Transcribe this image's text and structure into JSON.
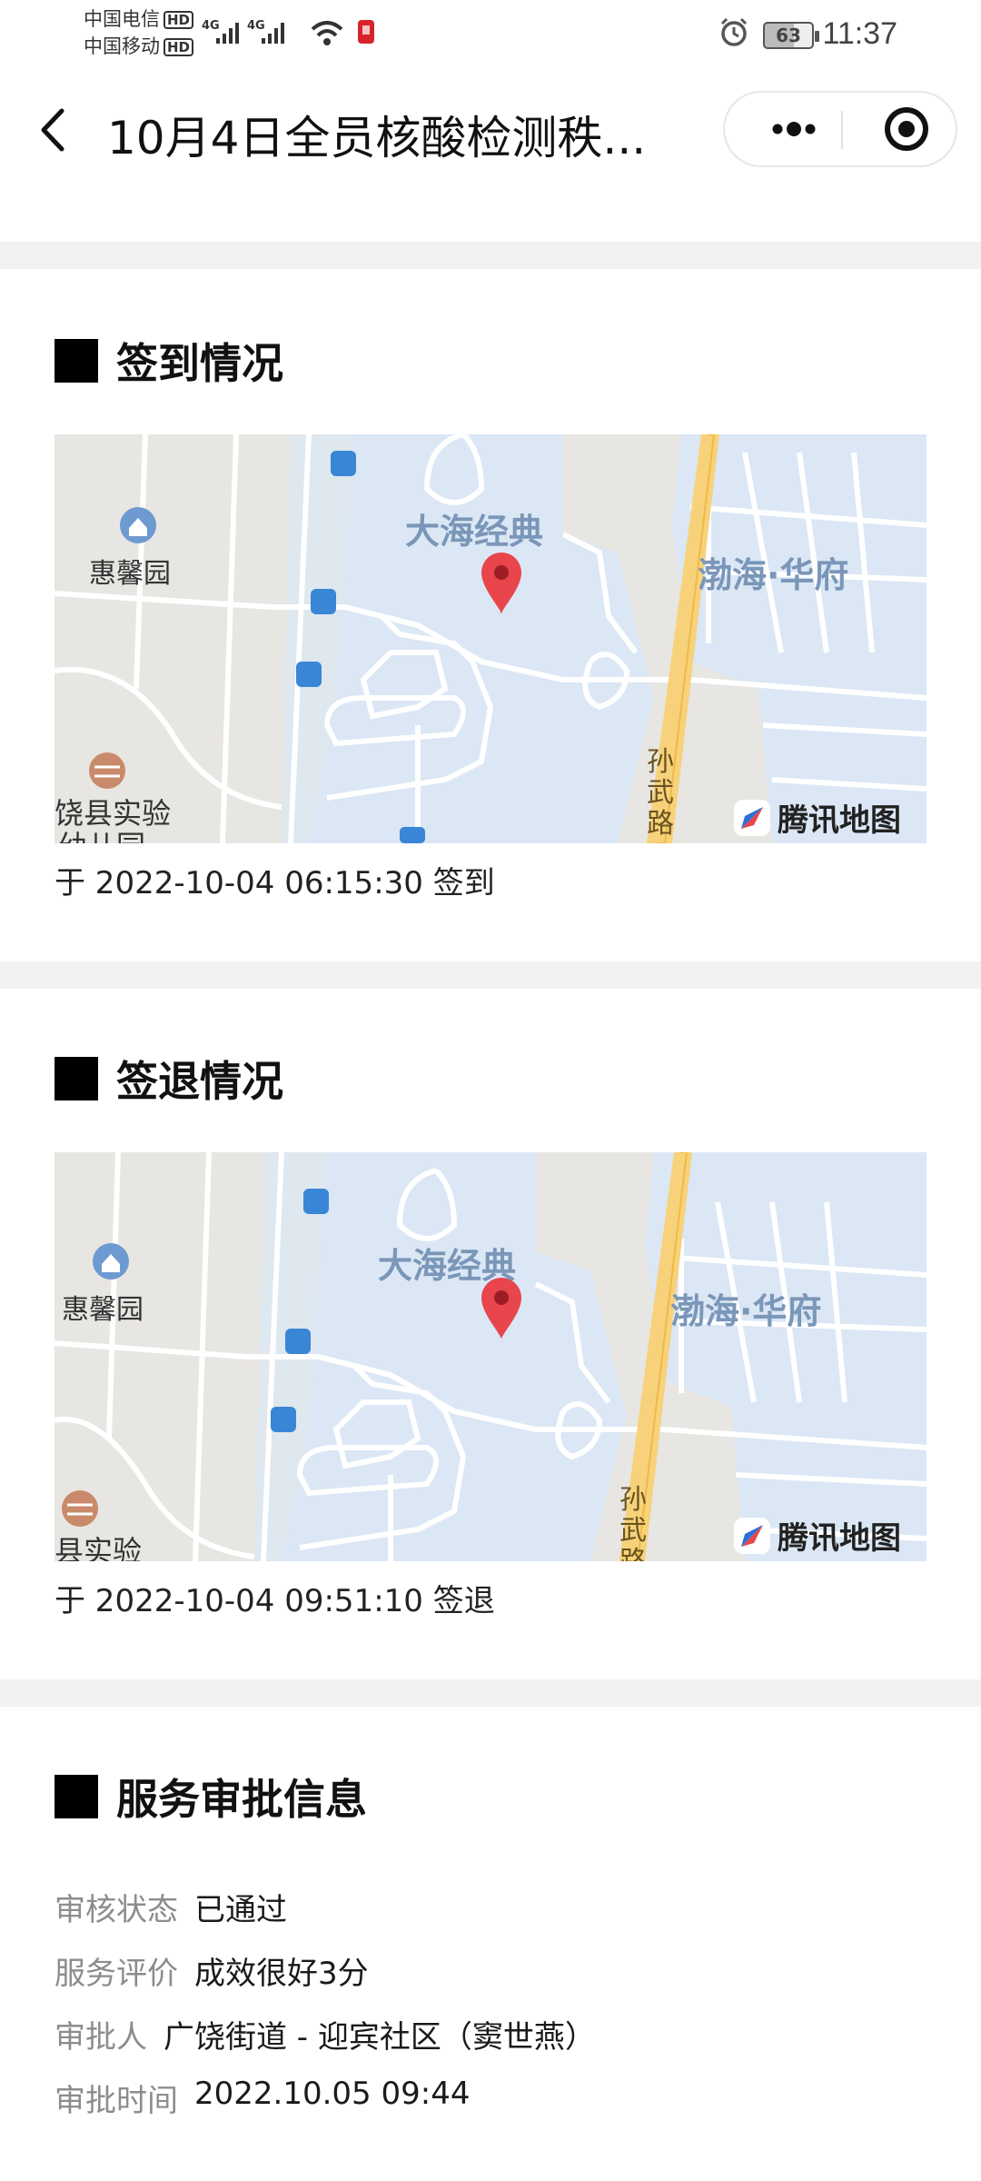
{
  "status": {
    "carrier1": "中国电信",
    "carrier2": "中国移动",
    "hd": "HD",
    "net": "4G",
    "battery": "63",
    "time": "11:37"
  },
  "nav": {
    "title": "10月4日全员核酸检测秩...",
    "more_icon": "more-dots-icon",
    "target_icon": "target-icon"
  },
  "sections": {
    "signin": {
      "title": "签到情况",
      "time_text": "于 2022-10-04 06:15:30 签到"
    },
    "signout": {
      "title": "签退情况",
      "time_text": "于 2022-10-04 09:51:10 签退"
    },
    "approval": {
      "title": "服务审批信息",
      "rows": [
        {
          "key": "审核状态",
          "value": "已通过"
        },
        {
          "key": "服务评价",
          "value": "成效很好3分"
        },
        {
          "key": "审批人",
          "value": "广饶街道 - 迎宾社区（窦世燕）"
        },
        {
          "key": "审批时间",
          "value": "2022.10.05 09:44"
        }
      ]
    }
  },
  "map": {
    "logo": "腾讯地图",
    "labels": {
      "community": "大海经典",
      "east": "渤海·华府",
      "west": "惠馨园",
      "school1": "饶县实验",
      "school1b": "幼儿园",
      "school2": "县实验",
      "road": "孙武路"
    },
    "colors": {
      "residential": "#dbe7f5",
      "road": "#f7d27a",
      "base": "#e8e6e2",
      "pin": "#e8454d"
    }
  }
}
